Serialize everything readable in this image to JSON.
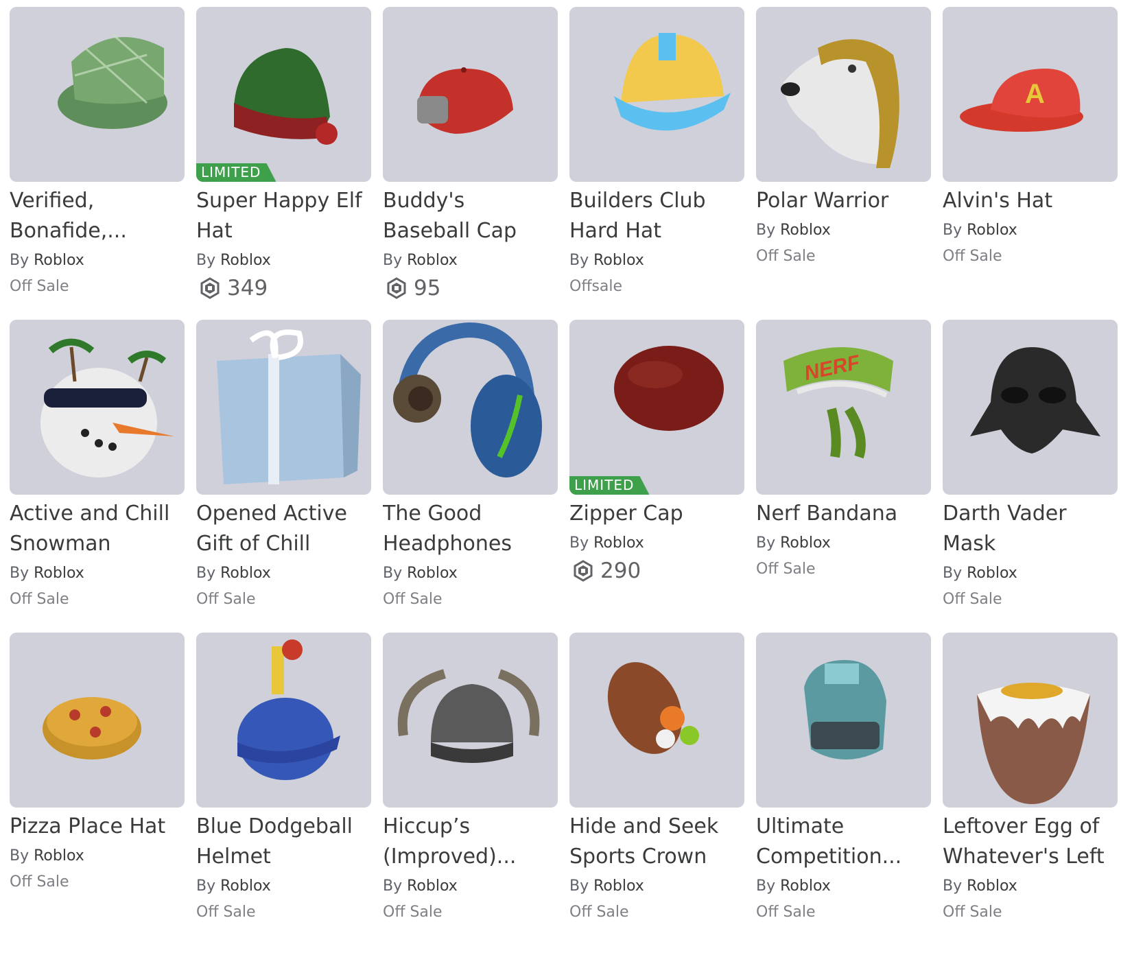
{
  "by_prefix": "By",
  "colors": {
    "thumb_bg": "#cfd0d9",
    "limited_badge": "#3ea04a",
    "text": "#393b3d"
  },
  "items": [
    {
      "name": "Verified, Bonafide,...",
      "creator": "Roblox",
      "status": "Off Sale",
      "limited": false,
      "art": "plaid-cap"
    },
    {
      "name": "Super Happy Elf Hat",
      "creator": "Roblox",
      "price": "349",
      "limited": true,
      "limited_label": "LIMITED",
      "art": "elf-hat"
    },
    {
      "name": "Buddy's Baseball Cap",
      "creator": "Roblox",
      "price": "95",
      "limited": false,
      "art": "red-cap-back"
    },
    {
      "name": "Builders Club Hard Hat",
      "creator": "Roblox",
      "status": "Offsale",
      "limited": false,
      "art": "hard-hat"
    },
    {
      "name": "Polar Warrior",
      "creator": "Roblox",
      "status": "Off Sale",
      "limited": false,
      "art": "polar-bear-helm"
    },
    {
      "name": "Alvin's Hat",
      "creator": "Roblox",
      "status": "Off Sale",
      "limited": false,
      "art": "red-cap-a"
    },
    {
      "name": "Active and Chill Snowman",
      "creator": "Roblox",
      "status": "Off Sale",
      "limited": false,
      "art": "snowman"
    },
    {
      "name": "Opened Active Gift of Chill",
      "creator": "Roblox",
      "status": "Off Sale",
      "limited": false,
      "art": "gift-box"
    },
    {
      "name": "The Good Headphones",
      "creator": "Roblox",
      "status": "Off Sale",
      "limited": false,
      "art": "headphones"
    },
    {
      "name": "Zipper Cap",
      "creator": "Roblox",
      "price": "290",
      "limited": true,
      "limited_label": "LIMITED",
      "art": "zipper-cap"
    },
    {
      "name": "Nerf Bandana",
      "creator": "Roblox",
      "status": "Off Sale",
      "limited": false,
      "art": "nerf-bandana",
      "art_text": "NERF"
    },
    {
      "name": "Darth Vader Mask",
      "creator": "Roblox",
      "status": "Off Sale",
      "limited": false,
      "art": "vader-mask"
    },
    {
      "name": "Pizza Place Hat",
      "creator": "Roblox",
      "status": "Off Sale",
      "limited": false,
      "art": "pizza"
    },
    {
      "name": "Blue Dodgeball Helmet",
      "creator": "Roblox",
      "status": "Off Sale",
      "limited": false,
      "art": "dodgeball-helmet"
    },
    {
      "name": "Hiccup’s (Improved)...",
      "creator": "Roblox",
      "status": "Off Sale",
      "limited": false,
      "art": "viking-helmet"
    },
    {
      "name": "Hide and Seek Sports Crown",
      "creator": "Roblox",
      "status": "Off Sale",
      "limited": false,
      "art": "sports-crown"
    },
    {
      "name": "Ultimate Competition...",
      "creator": "Roblox",
      "status": "Off Sale",
      "limited": false,
      "art": "robot-helmet"
    },
    {
      "name": "Leftover Egg of Whatever's Left",
      "creator": "Roblox",
      "status": "Off Sale",
      "limited": false,
      "art": "egg"
    }
  ]
}
